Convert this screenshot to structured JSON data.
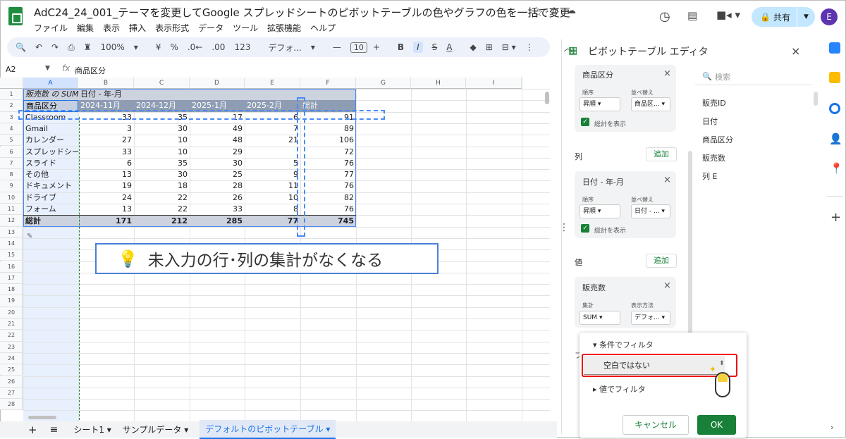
{
  "app": {
    "title": "AdC24_24_001_テーマを変更してGoogle スプレッドシートのピボットテーブルの色やグラフの色を一括で変更",
    "menu": [
      "ファイル",
      "編集",
      "表示",
      "挿入",
      "表示形式",
      "データ",
      "ツール",
      "拡張機能",
      "ヘルプ"
    ],
    "share_label": "共有",
    "avatar": "E"
  },
  "toolbar": {
    "zoom": "100%",
    "currency": "¥",
    "percent": "%",
    "dec_less": ".0←",
    "dec_more": ".00",
    "num_format": "123",
    "font": "デフォ...",
    "font_size": "10",
    "bold": "B",
    "italic": "I",
    "strike": "S",
    "text_color": "A"
  },
  "formula": {
    "cell": "A2",
    "fx": "fx",
    "value": "商品区分"
  },
  "grid": {
    "columns": [
      "A",
      "B",
      "C",
      "D",
      "E",
      "F",
      "G",
      "H",
      "I"
    ],
    "rows": [
      "1",
      "2",
      "3",
      "4",
      "5",
      "6",
      "7",
      "8",
      "9",
      "10",
      "11",
      "12",
      "13",
      "14",
      "15",
      "16",
      "17",
      "18",
      "19",
      "20",
      "21",
      "22",
      "23",
      "24",
      "25",
      "26",
      "27",
      "28"
    ],
    "r1_a": "販売数 の SUM",
    "r1_b": "日付 - 年-月",
    "headers": [
      "商品区分",
      "2024-11月",
      "2024-12月",
      "2025-1月",
      "2025-2月",
      "総計"
    ],
    "data": [
      [
        "Classroom",
        "33",
        "35",
        "17",
        "6",
        "91"
      ],
      [
        "Gmail",
        "3",
        "30",
        "49",
        "7",
        "89"
      ],
      [
        "カレンダー",
        "27",
        "10",
        "48",
        "21",
        "106"
      ],
      [
        "スプレッドシー",
        "33",
        "10",
        "29",
        "",
        "72"
      ],
      [
        "スライド",
        "6",
        "35",
        "30",
        "5",
        "76"
      ],
      [
        "その他",
        "13",
        "30",
        "25",
        "9",
        "77"
      ],
      [
        "ドキュメント",
        "19",
        "18",
        "28",
        "11",
        "76"
      ],
      [
        "ドライブ",
        "24",
        "22",
        "26",
        "10",
        "82"
      ],
      [
        "フォーム",
        "13",
        "22",
        "33",
        "8",
        "76"
      ]
    ],
    "total": [
      "総計",
      "171",
      "212",
      "285",
      "77",
      "745"
    ]
  },
  "callout": {
    "text": "未入力の行･列の集計がなくなる"
  },
  "tabs": {
    "add": "+",
    "list": "≡",
    "items": [
      "シート1",
      "サンプルデータ",
      "デフォルトのピボットテーブル"
    ]
  },
  "panel": {
    "title": "ピボットテーブル エディタ",
    "close": "×",
    "search_placeholder": "検索",
    "rows_card": {
      "title": "商品区分",
      "order_label": "順序",
      "sort_label": "並べ替え",
      "order": "昇順",
      "sort": "商品区...",
      "show_totals": "総計を表示"
    },
    "columns_label": "列",
    "add": "追加",
    "cols_card": {
      "title": "日付 - 年-月",
      "order_label": "順序",
      "sort_label": "並べ替え",
      "order": "昇順",
      "sort": "日付 - ...",
      "show_totals": "総計を表示"
    },
    "values_label": "値",
    "values_card": {
      "title": "販売数",
      "agg_label": "集計",
      "display_label": "表示方法",
      "agg": "SUM",
      "display": "デフォ..."
    },
    "filter_letter": "フ",
    "fields": [
      "販売ID",
      "日付",
      "商品区分",
      "販売数",
      "列 E"
    ]
  },
  "popup": {
    "by_condition": "条件でフィルタ",
    "condition": "空白ではない",
    "by_value": "値でフィルタ",
    "cancel": "キャンセル",
    "ok": "OK"
  },
  "colors": {
    "header_bg": "#8e9db4",
    "row1_bg": "#ccd3df",
    "selection": "#e8f0fe",
    "accent": "#188038",
    "callout_border": "#4a7fd4",
    "highlight": "#e00"
  }
}
